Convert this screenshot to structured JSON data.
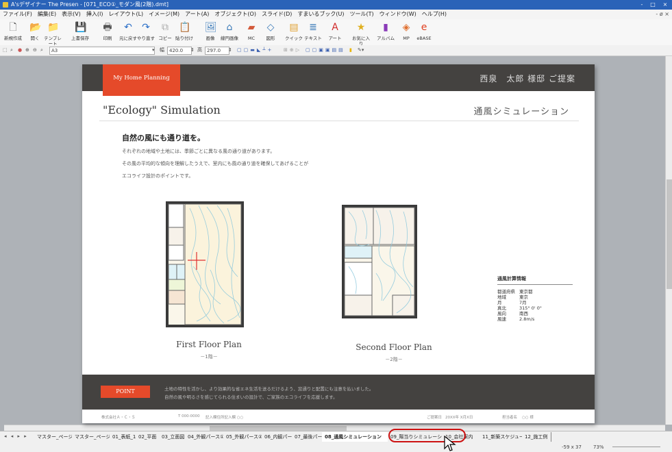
{
  "window": {
    "title": "A'sデザイナー The Presen - [071_ECO①_モダン風(2階).dmt]",
    "controls": [
      "-",
      "□",
      "×"
    ]
  },
  "menubar": {
    "items": [
      "ファイル(F)",
      "編集(E)",
      "表示(V)",
      "挿入(I)",
      "レイアウト(L)",
      "イメージ(M)",
      "アート(A)",
      "オブジェクト(O)",
      "スライド(D)",
      "すまいるブック(U)",
      "ツール(T)",
      "ウィンドウ(W)",
      "ヘルプ(H)"
    ],
    "system": "- ø ×"
  },
  "ribbon": {
    "buttons": [
      {
        "label": "新規作成",
        "icon": "new-doc-icon",
        "glyph": "🗋"
      },
      {
        "label": "開く",
        "icon": "open-folder-icon",
        "glyph": "📂"
      },
      {
        "label": "テンプレート",
        "icon": "template-icon",
        "glyph": "📁"
      },
      {
        "label": "上書保存",
        "icon": "save-icon",
        "glyph": "💾"
      },
      {
        "label": "印刷",
        "icon": "print-icon",
        "glyph": "🖶"
      },
      {
        "label": "元に戻す",
        "icon": "undo-icon",
        "glyph": "↶"
      },
      {
        "label": "やり直す",
        "icon": "redo-icon",
        "glyph": "↷"
      },
      {
        "label": "コピー",
        "icon": "copy-icon",
        "glyph": "⧉"
      },
      {
        "label": "貼り付け",
        "icon": "paste-icon",
        "glyph": "📋"
      },
      {
        "label": "画像",
        "icon": "image-icon",
        "glyph": "🖼"
      },
      {
        "label": "線円画像",
        "icon": "house-image-icon",
        "glyph": "⌂"
      },
      {
        "label": "MC",
        "icon": "mc-icon",
        "glyph": "▰"
      },
      {
        "label": "図形",
        "icon": "shape-icon",
        "glyph": "◇"
      },
      {
        "label": "クイック",
        "icon": "quick-icon",
        "glyph": "▤"
      },
      {
        "label": "テキスト",
        "icon": "text-icon",
        "glyph": "≣"
      },
      {
        "label": "アート",
        "icon": "art-text-icon",
        "glyph": "A"
      },
      {
        "label": "お気に入り",
        "icon": "star-icon",
        "glyph": "★"
      },
      {
        "label": "アルバム",
        "icon": "album-icon",
        "glyph": "▮"
      },
      {
        "label": "MP",
        "icon": "mp-icon",
        "glyph": "◈"
      },
      {
        "label": "eBASE",
        "icon": "ebase-icon",
        "glyph": "e"
      }
    ]
  },
  "toolbar2": {
    "paper": "A3",
    "width_label": "幅",
    "width_value": "420.0",
    "height_label": "高",
    "height_value": "297.0"
  },
  "page": {
    "header_tab": "My Home Planning",
    "client": "西泉　太郎 様邸 ご提案",
    "section_title": "\"Ecology\" Simulation",
    "section_title_jp": "通風シミュレーション",
    "lead": "自然の風にも通り道を。",
    "body_lines": [
      "それぞれの地域や土地には、季節ごとに異なる風の通り道があります。",
      "その風の平均的な傾向を理解したうえで、室内にも風の通り道を確保してあげることが",
      "エコライフ設計のポイントです。"
    ],
    "floor1": {
      "caption": "First Floor Plan",
      "sub": "－1階－"
    },
    "floor2": {
      "caption": "Second Floor Plan",
      "sub": "－2階－"
    },
    "calc": {
      "title": "通風計算情報",
      "rows": [
        {
          "k": "都道府県",
          "v": "東京都"
        },
        {
          "k": "地域",
          "v": "東京"
        },
        {
          "k": "月",
          "v": "7月"
        },
        {
          "k": "真北",
          "v": "315° 0' 0\""
        },
        {
          "k": "風向",
          "v": "南西"
        },
        {
          "k": "風速",
          "v": "2.8m/s"
        }
      ]
    },
    "point_tag": "POINT",
    "point_lines": [
      "土地の特性を活かし、より効果的な省エネ生活を送るだけるよう、窓通りと配置にも注意を払いました。",
      "自然の風や明るさを感じてられる住まいの設計で、ご家族のエコライフを応援します。"
    ],
    "footer": {
      "company": "株式会社Ａ・Ｃ・Ｓ",
      "tel": "T 000-0000",
      "address": "記入欄住所記入欄 ○○",
      "date_label": "ご提案日",
      "date": "20XX年 X月X日",
      "person_label": "担当者名",
      "person": "○○ 様"
    }
  },
  "tabs": {
    "nav": "◂ ◂ ▸ ▸",
    "items": [
      "マスター_ページ1",
      "マスター_ページ2",
      "01_表紙_1",
      "02_平面",
      "03_立面図",
      "04_外観パース①",
      "05_外観パース②",
      "06_内観パース",
      "07_最後パース",
      "08_通風シミュレーション",
      "09_陽当りシミュレーション",
      "10_会社案内",
      "11_新築スケジュール",
      "12_施工例"
    ],
    "active_index": 9
  },
  "status": {
    "coords": "-59 x 37",
    "zoom": "73%"
  },
  "colors": {
    "accent_red": "#e54a2a",
    "dark_band": "#444240",
    "titlebar_blue": "#2a63b8",
    "highlight_red": "#cc1111"
  }
}
